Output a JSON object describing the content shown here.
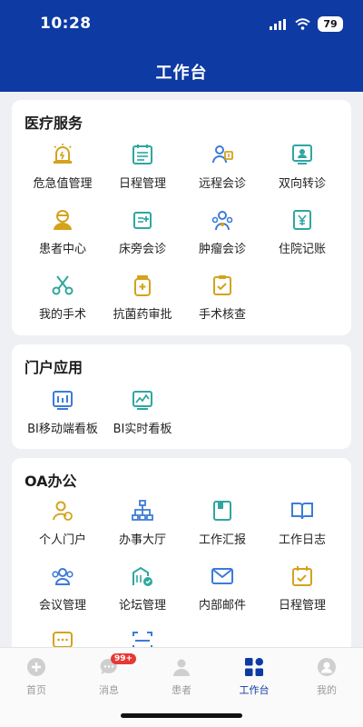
{
  "status_bar": {
    "time": "10:28",
    "battery": "79"
  },
  "header": {
    "title": "工作台"
  },
  "colors": {
    "header_bg": "#0e3aa3",
    "icon_teal": "#2ea7a0",
    "icon_gold": "#d4a21b",
    "icon_blue": "#3d7bd8",
    "badge_red": "#e53935"
  },
  "sections": {
    "medical": {
      "title": "医疗服务",
      "items": [
        {
          "label": "危急值管理",
          "icon": "alarm-light-icon"
        },
        {
          "label": "日程管理",
          "icon": "calendar-list-icon"
        },
        {
          "label": "远程会诊",
          "icon": "remote-consult-icon"
        },
        {
          "label": "双向转诊",
          "icon": "referral-monitor-icon"
        },
        {
          "label": "患者中心",
          "icon": "patient-icon"
        },
        {
          "label": "床旁会诊",
          "icon": "bedside-card-icon"
        },
        {
          "label": "肿瘤会诊",
          "icon": "tumor-consult-icon"
        },
        {
          "label": "住院记账",
          "icon": "billing-yen-icon"
        },
        {
          "label": "我的手术",
          "icon": "scissors-icon"
        },
        {
          "label": "抗菌药审批",
          "icon": "medicine-bottle-icon"
        },
        {
          "label": "手术核查",
          "icon": "surgery-check-icon"
        }
      ]
    },
    "portal": {
      "title": "门户应用",
      "items": [
        {
          "label": "BI移动端看板",
          "icon": "bi-dashboard-icon"
        },
        {
          "label": "BI实时看板",
          "icon": "bi-realtime-icon"
        }
      ]
    },
    "oa": {
      "title": "OA办公",
      "items": [
        {
          "label": "个人门户",
          "icon": "personal-portal-icon"
        },
        {
          "label": "办事大厅",
          "icon": "org-chart-icon"
        },
        {
          "label": "工作汇报",
          "icon": "report-book-icon"
        },
        {
          "label": "工作日志",
          "icon": "open-book-icon"
        },
        {
          "label": "会议管理",
          "icon": "meeting-group-icon"
        },
        {
          "label": "论坛管理",
          "icon": "forum-building-icon"
        },
        {
          "label": "内部邮件",
          "icon": "mail-icon"
        },
        {
          "label": "日程管理",
          "icon": "calendar-icon"
        }
      ]
    }
  },
  "tabbar": {
    "tabs": [
      {
        "label": "首页",
        "icon": "home-icon"
      },
      {
        "label": "消息",
        "icon": "message-icon",
        "badge": "99+"
      },
      {
        "label": "患者",
        "icon": "patient-tab-icon"
      },
      {
        "label": "工作台",
        "icon": "workbench-icon",
        "active": true
      },
      {
        "label": "我的",
        "icon": "profile-icon"
      }
    ]
  }
}
